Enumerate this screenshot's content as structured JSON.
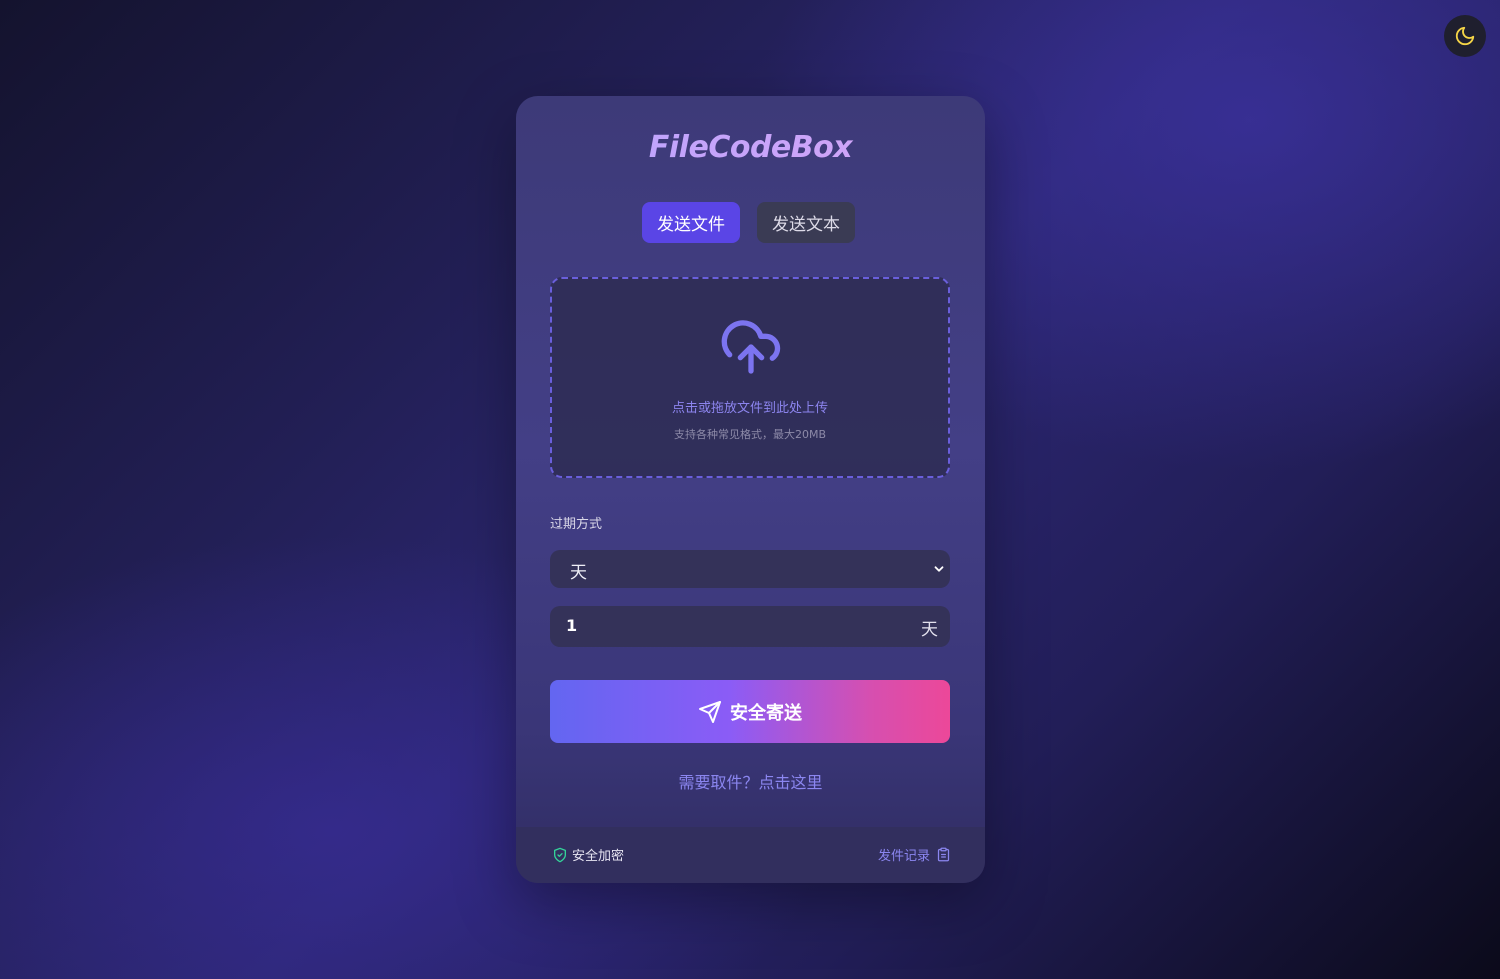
{
  "app": {
    "title": "FileCodeBox"
  },
  "theme_toggle": {
    "icon": "moon-icon",
    "icon_color": "#f5d547"
  },
  "tabs": [
    {
      "label": "发送文件",
      "active": true
    },
    {
      "label": "发送文本",
      "active": false
    }
  ],
  "upload": {
    "icon": "cloud-upload-icon",
    "main_text": "点击或拖放文件到此处上传",
    "sub_text": "支持各种常见格式，最大20MB"
  },
  "expire": {
    "label": "过期方式",
    "selected": "天",
    "value": "1",
    "unit": "天"
  },
  "send_button": {
    "label": "安全寄送",
    "icon": "send-icon"
  },
  "retrieve_link": "需要取件？点击这里",
  "footer": {
    "secure_label": "安全加密",
    "secure_icon": "shield-check-icon",
    "history_label": "发件记录",
    "history_icon": "clipboard-icon"
  },
  "colors": {
    "accent": "#5a45e6",
    "link": "#8b86f0",
    "secure_icon": "#34d399"
  }
}
